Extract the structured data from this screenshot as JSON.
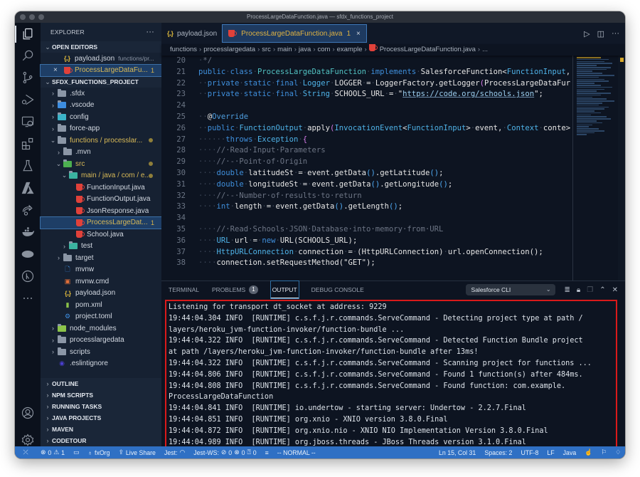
{
  "window": {
    "title": "ProcessLargeDataFunction.java — sfdx_functions_project"
  },
  "activity_bar": [
    {
      "name": "explorer-icon",
      "active": true
    },
    {
      "name": "search-icon"
    },
    {
      "name": "source-control-icon"
    },
    {
      "name": "run-debug-icon"
    },
    {
      "name": "remote-explorer-icon"
    },
    {
      "name": "extensions-icon"
    },
    {
      "name": "testing-icon"
    },
    {
      "name": "azure-icon"
    },
    {
      "name": "live-share-icon"
    },
    {
      "name": "docker-icon"
    },
    {
      "name": "salesforce-icon"
    },
    {
      "name": "git-graph-icon"
    },
    {
      "name": "more-icon"
    },
    {
      "name": "accounts-icon"
    },
    {
      "name": "settings-gear-icon"
    }
  ],
  "sidebar": {
    "title": "EXPLORER",
    "more": "···",
    "open_editors": {
      "label": "OPEN EDITORS",
      "items": [
        {
          "label": "payload.json",
          "desc": "functions/pr...",
          "icon": "json-icon"
        },
        {
          "label": "ProcessLargeDataFu...",
          "badge": "1",
          "icon": "java-icon",
          "close": "×"
        }
      ]
    },
    "project": {
      "label": "SFDX_FUNCTIONS_PROJECT",
      "tree": [
        {
          "label": ".sfdx",
          "type": "folder",
          "depth": 0,
          "chev": "›"
        },
        {
          "label": ".vscode",
          "type": "folder-vscode",
          "depth": 0,
          "chev": "›"
        },
        {
          "label": "config",
          "type": "folder-config",
          "depth": 0,
          "chev": "›"
        },
        {
          "label": "force-app",
          "type": "folder",
          "depth": 0,
          "chev": "›"
        },
        {
          "label": "functions / processlar...",
          "type": "folder-open",
          "depth": 0,
          "chev": "⌄",
          "modified": true
        },
        {
          "label": ".mvn",
          "type": "folder",
          "depth": 1,
          "chev": "›"
        },
        {
          "label": "src",
          "type": "folder-src",
          "depth": 1,
          "chev": "⌄",
          "modified": true
        },
        {
          "label": "main / java / com / e...",
          "type": "folder-main",
          "depth": 2,
          "chev": "⌄",
          "modified": true
        },
        {
          "label": "FunctionInput.java",
          "type": "java",
          "depth": 3
        },
        {
          "label": "FunctionOutput.java",
          "type": "java",
          "depth": 3
        },
        {
          "label": "JsonResponse.java",
          "type": "java",
          "depth": 3
        },
        {
          "label": "ProcessLargeDat...",
          "type": "java",
          "depth": 3,
          "selected": true,
          "badge": "1"
        },
        {
          "label": "School.java",
          "type": "java",
          "depth": 3
        },
        {
          "label": "test",
          "type": "folder-test",
          "depth": 2,
          "chev": "›"
        },
        {
          "label": "target",
          "type": "folder",
          "depth": 1,
          "chev": "›"
        },
        {
          "label": "mvnw",
          "type": "file",
          "depth": 1
        },
        {
          "label": "mvnw.cmd",
          "type": "cmd",
          "depth": 1
        },
        {
          "label": "payload.json",
          "type": "json",
          "depth": 1
        },
        {
          "label": "pom.xml",
          "type": "xml",
          "depth": 1
        },
        {
          "label": "project.toml",
          "type": "toml",
          "depth": 1
        },
        {
          "label": "node_modules",
          "type": "folder-node",
          "depth": 0,
          "chev": "›"
        },
        {
          "label": "processlargedata",
          "type": "folder",
          "depth": 0,
          "chev": "›"
        },
        {
          "label": "scripts",
          "type": "folder-scripts",
          "depth": 0,
          "chev": "›"
        },
        {
          "label": ".eslintignore",
          "type": "eslint",
          "depth": 0
        }
      ]
    },
    "collapsed_sections": [
      "OUTLINE",
      "NPM SCRIPTS",
      "RUNNING TASKS",
      "JAVA PROJECTS",
      "MAVEN",
      "CODETOUR"
    ]
  },
  "tabs": [
    {
      "label": "payload.json",
      "icon": "json-icon",
      "active": false
    },
    {
      "label": "ProcessLargeDataFunction.java",
      "icon": "java-icon",
      "active": true,
      "badge": "1",
      "close": "×"
    }
  ],
  "tab_actions": {
    "run": "▷",
    "split": "◫",
    "more": "···"
  },
  "breadcrumb": [
    "functions",
    "processlargedata",
    "src",
    "main",
    "java",
    "com",
    "example",
    "ProcessLargeDataFunction.java",
    "..."
  ],
  "code": {
    "lines": [
      {
        "n": "20",
        "segs": [
          [
            "ws",
            "·"
          ],
          [
            "com",
            "*/"
          ]
        ]
      },
      {
        "n": "21",
        "segs": [
          [
            "kw",
            "public"
          ],
          [
            "ws",
            "·"
          ],
          [
            "kw",
            "class"
          ],
          [
            "ws",
            "·"
          ],
          [
            "cls",
            "ProcessLargeDataFunction"
          ],
          [
            "ws",
            "·"
          ],
          [
            "kw",
            "implements"
          ],
          [
            "ws",
            "·"
          ],
          [
            "fn",
            "SalesforceFunction<"
          ],
          [
            "ty",
            "FunctionInput"
          ],
          [
            "fn",
            ","
          ]
        ]
      },
      {
        "n": "22",
        "segs": [
          [
            "ws",
            "··"
          ],
          [
            "kw",
            "private"
          ],
          [
            "ws",
            "·"
          ],
          [
            "kw",
            "static"
          ],
          [
            "ws",
            "·"
          ],
          [
            "kw",
            "final"
          ],
          [
            "ws",
            "·"
          ],
          [
            "ty",
            "Logger"
          ],
          [
            "ws",
            "·"
          ],
          [
            "fn",
            "LOGGER"
          ],
          [
            "ws",
            "·"
          ],
          [
            "fn",
            "="
          ],
          [
            "ws",
            "·"
          ],
          [
            "fn",
            "LoggerFactory.getLogger"
          ],
          [
            "paren",
            "("
          ],
          [
            "fn",
            "ProcessLargeDataFur"
          ]
        ]
      },
      {
        "n": "23",
        "segs": [
          [
            "ws",
            "··"
          ],
          [
            "kw",
            "private"
          ],
          [
            "ws",
            "·"
          ],
          [
            "kw",
            "static"
          ],
          [
            "ws",
            "·"
          ],
          [
            "kw",
            "final"
          ],
          [
            "ws",
            "·"
          ],
          [
            "ty",
            "String"
          ],
          [
            "ws",
            "·"
          ],
          [
            "fn",
            "SCHOOLS_URL"
          ],
          [
            "ws",
            "·"
          ],
          [
            "fn",
            "="
          ],
          [
            "ws",
            "·"
          ],
          [
            "fn",
            "\""
          ],
          [
            "str",
            "https://code.org/schools.json"
          ],
          [
            "fn",
            "\";"
          ]
        ]
      },
      {
        "n": "24",
        "segs": []
      },
      {
        "n": "25",
        "segs": [
          [
            "ws",
            "··"
          ],
          [
            "fn",
            "@"
          ],
          [
            "ann",
            "Override"
          ]
        ]
      },
      {
        "n": "26",
        "segs": [
          [
            "ws",
            "··"
          ],
          [
            "kw",
            "public"
          ],
          [
            "ws",
            "·"
          ],
          [
            "ty",
            "FunctionOutput"
          ],
          [
            "ws",
            "·"
          ],
          [
            "fn",
            "apply"
          ],
          [
            "paren",
            "("
          ],
          [
            "ty",
            "InvocationEvent"
          ],
          [
            "fn",
            "<"
          ],
          [
            "ty",
            "FunctionInput"
          ],
          [
            "fn",
            ">"
          ],
          [
            "ws",
            "·"
          ],
          [
            "fn",
            "event,"
          ],
          [
            "ws",
            "·"
          ],
          [
            "ty",
            "Context"
          ],
          [
            "ws",
            "·"
          ],
          [
            "fn",
            "conte>"
          ]
        ]
      },
      {
        "n": "27",
        "segs": [
          [
            "ws",
            "······"
          ],
          [
            "kw",
            "throws"
          ],
          [
            "ws",
            "·"
          ],
          [
            "ty",
            "Exception"
          ],
          [
            "ws",
            "·"
          ],
          [
            "paren",
            "{"
          ]
        ]
      },
      {
        "n": "28",
        "segs": [
          [
            "ws",
            "····"
          ],
          [
            "com",
            "//·Read·Input·Parameters"
          ]
        ]
      },
      {
        "n": "29",
        "segs": [
          [
            "ws",
            "····"
          ],
          [
            "com",
            "//·-·Point·of·Origin"
          ]
        ]
      },
      {
        "n": "30",
        "segs": [
          [
            "ws",
            "····"
          ],
          [
            "kw",
            "double"
          ],
          [
            "ws",
            "·"
          ],
          [
            "fn",
            "latitudeSt"
          ],
          [
            "ws",
            "·"
          ],
          [
            "fn",
            "="
          ],
          [
            "ws",
            "·"
          ],
          [
            "fn",
            "event.getData"
          ],
          [
            "paren2",
            "()"
          ],
          [
            "fn",
            ".getLatitude"
          ],
          [
            "paren2",
            "()"
          ],
          [
            "fn",
            ";"
          ]
        ]
      },
      {
        "n": "31",
        "segs": [
          [
            "ws",
            "····"
          ],
          [
            "kw",
            "double"
          ],
          [
            "ws",
            "·"
          ],
          [
            "fn",
            "longitudeSt"
          ],
          [
            "ws",
            "·"
          ],
          [
            "fn",
            "="
          ],
          [
            "ws",
            "·"
          ],
          [
            "fn",
            "event.getData"
          ],
          [
            "paren2",
            "()"
          ],
          [
            "fn",
            ".getLongitude"
          ],
          [
            "paren2",
            "()"
          ],
          [
            "fn",
            ";"
          ]
        ]
      },
      {
        "n": "32",
        "segs": [
          [
            "ws",
            "····"
          ],
          [
            "com",
            "//·-·Number·of·results·to·return"
          ]
        ]
      },
      {
        "n": "33",
        "segs": [
          [
            "ws",
            "····"
          ],
          [
            "kw",
            "int"
          ],
          [
            "ws",
            "·"
          ],
          [
            "fn",
            "length"
          ],
          [
            "ws",
            "·"
          ],
          [
            "fn",
            "="
          ],
          [
            "ws",
            "·"
          ],
          [
            "fn",
            "event.getData"
          ],
          [
            "paren2",
            "()"
          ],
          [
            "fn",
            ".getLength"
          ],
          [
            "paren2",
            "()"
          ],
          [
            "fn",
            ";"
          ]
        ]
      },
      {
        "n": "34",
        "segs": []
      },
      {
        "n": "35",
        "segs": [
          [
            "ws",
            "····"
          ],
          [
            "com",
            "//·Read·Schools·JSON·Database·into·memory·from·URL"
          ]
        ]
      },
      {
        "n": "36",
        "segs": [
          [
            "ws",
            "····"
          ],
          [
            "ty",
            "URL"
          ],
          [
            "ws",
            "·"
          ],
          [
            "fn",
            "url"
          ],
          [
            "ws",
            "·"
          ],
          [
            "fn",
            "="
          ],
          [
            "ws",
            "·"
          ],
          [
            "kw",
            "new"
          ],
          [
            "ws",
            "·"
          ],
          [
            "fn",
            "URL(SCHOOLS_URL);"
          ]
        ]
      },
      {
        "n": "37",
        "segs": [
          [
            "ws",
            "····"
          ],
          [
            "ty",
            "HttpURLConnection"
          ],
          [
            "ws",
            "·"
          ],
          [
            "fn",
            "connection"
          ],
          [
            "ws",
            "·"
          ],
          [
            "fn",
            "="
          ],
          [
            "ws",
            "·"
          ],
          [
            "fn",
            "(HttpURLConnection)"
          ],
          [
            "ws",
            "·"
          ],
          [
            "fn",
            "url.openConnection();"
          ]
        ]
      },
      {
        "n": "38",
        "segs": [
          [
            "ws",
            "····"
          ],
          [
            "fn",
            "connection.setRequestMethod(\"GET\");"
          ]
        ]
      }
    ]
  },
  "panel": {
    "tabs": [
      {
        "label": "TERMINAL"
      },
      {
        "label": "PROBLEMS",
        "badge": "1"
      },
      {
        "label": "OUTPUT",
        "active": true
      },
      {
        "label": "DEBUG CONSOLE"
      }
    ],
    "channel": "Salesforce CLI",
    "output_lines": [
      "Listening for transport dt_socket at address: 9229",
      "19:44:04.304 INFO  [RUNTIME] c.s.f.j.r.commands.ServeCommand - Detecting project type at path /",
      "layers/heroku_jvm-function-invoker/function-bundle ...",
      "19:44:04.322 INFO  [RUNTIME] c.s.f.j.r.commands.ServeCommand - Detected Function Bundle project",
      "at path /layers/heroku_jvm-function-invoker/function-bundle after 13ms!",
      "19:44:04.322 INFO  [RUNTIME] c.s.f.j.r.commands.ServeCommand - Scanning project for functions ...",
      "19:44:04.806 INFO  [RUNTIME] c.s.f.j.r.commands.ServeCommand - Found 1 function(s) after 484ms.",
      "19:44:04.808 INFO  [RUNTIME] c.s.f.j.r.commands.ServeCommand - Found function: com.example.",
      "ProcessLargeDataFunction",
      "19:44:04.841 INFO  [RUNTIME] io.undertow - starting server: Undertow - 2.2.7.Final",
      "19:44:04.851 INFO  [RUNTIME] org.xnio - XNIO version 3.8.0.Final",
      "19:44:04.872 INFO  [RUNTIME] org.xnio.nio - XNIO NIO Implementation Version 3.8.0.Final",
      "19:44:04.989 INFO  [RUNTIME] org.jboss.threads - JBoss Threads version 3.1.0.Final"
    ]
  },
  "statusbar": {
    "remote": "⤫",
    "errors": "0",
    "warnings": "1",
    "org": "fxOrg",
    "live_share": "Live Share",
    "jest": "Jest:",
    "jest_ws": "Jest-WS:",
    "jest_pass": "0",
    "jest_fail": "0",
    "jest_unknown": "0",
    "mode": "-- NORMAL --",
    "position": "Ln 15, Col 31",
    "spaces": "Spaces: 2",
    "encoding": "UTF-8",
    "eol": "LF",
    "language": "Java"
  },
  "colors": {
    "accent": "#2f70c4",
    "highlight_border": "#d91a1a",
    "modified": "#d8b957"
  }
}
